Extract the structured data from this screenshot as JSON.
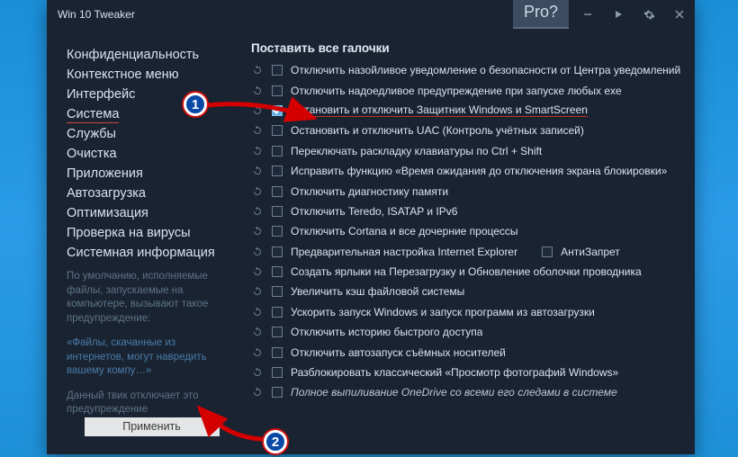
{
  "titlebar": {
    "title": "Win 10 Tweaker",
    "pro": "Pro?"
  },
  "sidebar": {
    "items": [
      {
        "label": "Конфиденциальность"
      },
      {
        "label": "Контекстное меню"
      },
      {
        "label": "Интерфейс"
      },
      {
        "label": "Система",
        "selected": true
      },
      {
        "label": "Службы"
      },
      {
        "label": "Очистка"
      },
      {
        "label": "Приложения"
      },
      {
        "label": "Автозагрузка"
      },
      {
        "label": "Оптимизация"
      },
      {
        "label": "Проверка на вирусы"
      },
      {
        "label": "Системная информация"
      }
    ],
    "note1": "По умолчанию, исполняемые файлы, запускаемые на компьютере, вызывают такое предупреждение:",
    "note2": "«Файлы, скачанные из интернетов, могут навредить вашему компу…»",
    "note3": "Данный твик отключает это предупреждение",
    "apply": "Применить"
  },
  "main": {
    "header": "Поставить все галочки",
    "rows": [
      {
        "label": "Отключить назойливое уведомление о безопасности от Центра уведомлений"
      },
      {
        "label": "Отключить надоедливое предупреждение при запуске любых exe"
      },
      {
        "label": "Остановить и отключить Защитник Windows и SmartScreen",
        "checked": true,
        "highlight": true
      },
      {
        "label": "Остановить и отключить UAC (Контроль учётных записей)"
      },
      {
        "label": "Переключать раскладку клавиатуры по Ctrl + Shift"
      },
      {
        "label": "Исправить функцию «Время ожидания до отключения экрана блокировки»"
      },
      {
        "label": "Отключить диагностику памяти"
      },
      {
        "label": "Отключить Teredo, ISATAP и IPv6"
      },
      {
        "label": "Отключить Cortana и все дочерние процессы"
      },
      {
        "label": "Предварительная настройка Internet Explorer",
        "extra": "АнтиЗапрет"
      },
      {
        "label": "Создать ярлыки на Перезагрузку и Обновление оболочки проводника"
      },
      {
        "label": "Увеличить кэш файловой системы"
      },
      {
        "label": "Ускорить запуск Windows и запуск программ из автозагрузки"
      },
      {
        "label": "Отключить историю быстрого доступа"
      },
      {
        "label": "Отключить автозапуск съёмных носителей"
      },
      {
        "label": "Разблокировать классический «Просмотр фотографий Windows»"
      },
      {
        "label": "Полное выпиливание OneDrive со всеми его следами в системе",
        "italic": true
      }
    ]
  },
  "markers": {
    "one": "1",
    "two": "2"
  }
}
